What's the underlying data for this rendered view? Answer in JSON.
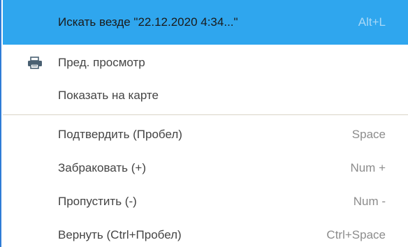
{
  "menu": {
    "search_everywhere": {
      "label": "Искать везде \"22.12.2020 4:34...\"",
      "shortcut": "Alt+L"
    },
    "preview": {
      "label": "Пред. просмотр",
      "icon": "printer-icon"
    },
    "show_on_map": {
      "label": "Показать на карте"
    },
    "confirm": {
      "label": "Подтвердить (Пробел)",
      "shortcut": "Space"
    },
    "reject": {
      "label": "Забраковать (+)",
      "shortcut": "Num +"
    },
    "skip": {
      "label": "Пропустить (-)",
      "shortcut": "Num -"
    },
    "return": {
      "label": "Вернуть (Ctrl+Пробел)",
      "shortcut": "Ctrl+Space"
    }
  },
  "colors": {
    "highlight": "#2fa6ee",
    "border": "#2f7cd6",
    "separator": "#d9d4c7",
    "text": "#444444",
    "shortcut_text": "#8c8c8c"
  }
}
